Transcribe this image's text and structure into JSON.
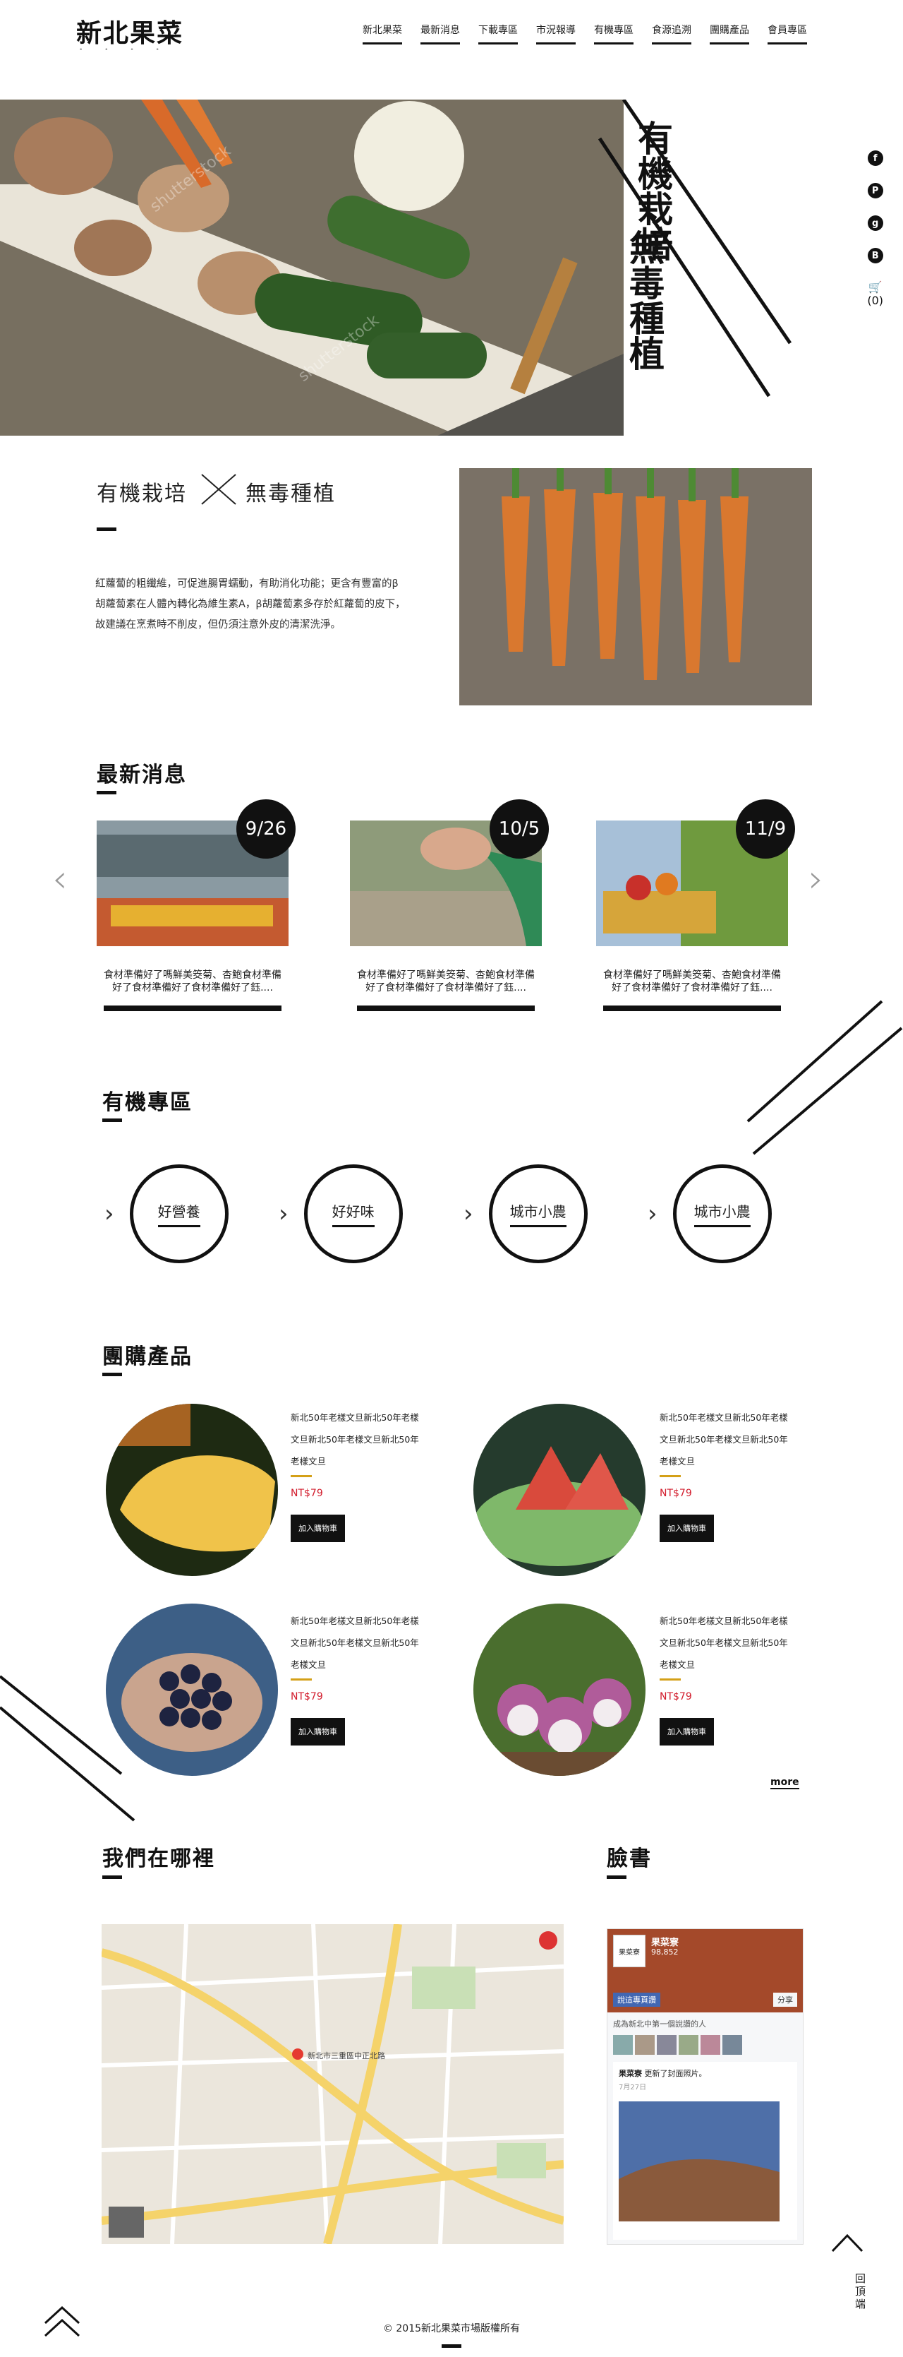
{
  "header": {
    "logo": "新北果菜",
    "logo_dots": "• • • •",
    "nav": [
      "新北果菜",
      "最新消息",
      "下載專區",
      "市況報導",
      "有機專區",
      "食源追溯",
      "團購產品",
      "會員專區"
    ]
  },
  "hero": {
    "line1": "有機栽培",
    "line2": "無毒種植",
    "watermark": "shutterstock"
  },
  "social": {
    "icons": [
      "facebook-icon",
      "plurk-icon",
      "googleplus-icon",
      "blogger-icon"
    ],
    "cart_count": "(0)"
  },
  "intro": {
    "title_left": "有機栽培",
    "title_right": "無毒種植",
    "paragraph": "紅蘿蔔的粗纖維，可促進腸胃蠕動，有助消化功能；更含有豐富的β胡蘿蔔素在人體內轉化為維生素A，β胡蘿蔔素多存於紅蘿蔔的皮下，故建議在烹煮時不削皮，但仍須注意外皮的清潔洗淨。"
  },
  "news": {
    "title": "最新消息",
    "items": [
      {
        "date": "9/26",
        "text": "食材準備好了嗎鮮美筊菊、杏鮑食材準備好了食材準備好了食材準備好了鈺...."
      },
      {
        "date": "10/5",
        "text": "食材準備好了嗎鮮美筊菊、杏鮑食材準備好了食材準備好了食材準備好了鈺...."
      },
      {
        "date": "11/9",
        "text": "食材準備好了嗎鮮美筊菊、杏鮑食材準備好了食材準備好了食材準備好了鈺...."
      }
    ]
  },
  "organic": {
    "title": "有機專區",
    "items": [
      "好營養",
      "好好味",
      "城市小農",
      "城市小農"
    ]
  },
  "products": {
    "title": "團購產品",
    "items": [
      {
        "desc": "新北50年老樣文旦新北50年老樣文旦新北50年老樣文旦新北50年老樣文旦",
        "price": "NT$79",
        "button": "加入購物車"
      },
      {
        "desc": "新北50年老樣文旦新北50年老樣文旦新北50年老樣文旦新北50年老樣文旦",
        "price": "NT$79",
        "button": "加入購物車"
      },
      {
        "desc": "新北50年老樣文旦新北50年老樣文旦新北50年老樣文旦新北50年老樣文旦",
        "price": "NT$79",
        "button": "加入購物車"
      },
      {
        "desc": "新北50年老樣文旦新北50年老樣文旦新北50年老樣文旦新北50年老樣文旦",
        "price": "NT$79",
        "button": "加入購物車"
      }
    ],
    "more": "more"
  },
  "where": {
    "title": "我們在哪裡",
    "map_marker": "新北市三重區中正北路"
  },
  "facebook": {
    "title": "臉書",
    "page_name": "果菜寮",
    "likes": "98,852",
    "like_button": "說這專頁讚",
    "share": "分享",
    "friends_text": "成為新北中第一個說讚的人",
    "post_author": "果菜寮",
    "post_text": "更新了封面照片。",
    "post_date": "7月27日"
  },
  "footer": {
    "copyright": "© 2015新北果菜市場版權所有",
    "to_top": "回頂端"
  }
}
